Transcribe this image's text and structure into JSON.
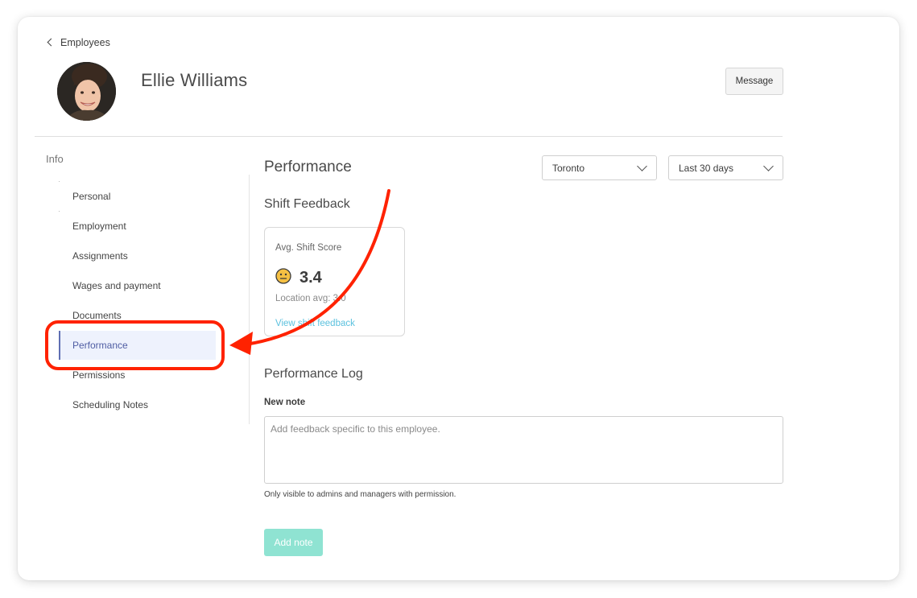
{
  "header": {
    "back_label": "Employees",
    "employee_name": "Ellie Williams",
    "message_label": "Message"
  },
  "sidebar": {
    "section_label": "Info",
    "items": [
      {
        "label": "Personal"
      },
      {
        "label": "Employment"
      },
      {
        "label": "Assignments"
      },
      {
        "label": "Wages and payment"
      },
      {
        "label": "Documents"
      },
      {
        "label": "Performance",
        "active": true
      },
      {
        "label": "Permissions"
      },
      {
        "label": "Scheduling Notes"
      }
    ]
  },
  "main": {
    "title": "Performance",
    "location_select": {
      "value": "Toronto"
    },
    "range_select": {
      "value": "Last 30 days"
    },
    "shift_feedback": {
      "title": "Shift Feedback",
      "avg_label": "Avg. Shift Score",
      "score": "3.4",
      "location_avg": "Location avg: 3.0",
      "view_link": "View shift feedback",
      "face_icon": "neutral-face-icon"
    },
    "performance_log": {
      "title": "Performance Log",
      "new_note_label": "New note",
      "note_placeholder": "Add feedback specific to this employee.",
      "help_text": "Only visible to admins and managers with permission.",
      "add_button": "Add note"
    }
  },
  "colors": {
    "accent_link": "#5bc1de",
    "active_nav_bg": "#eef2fd",
    "active_nav_text": "#4f5da3",
    "add_button_bg": "#8fe3d2",
    "annotation_red": "#ff2200"
  }
}
